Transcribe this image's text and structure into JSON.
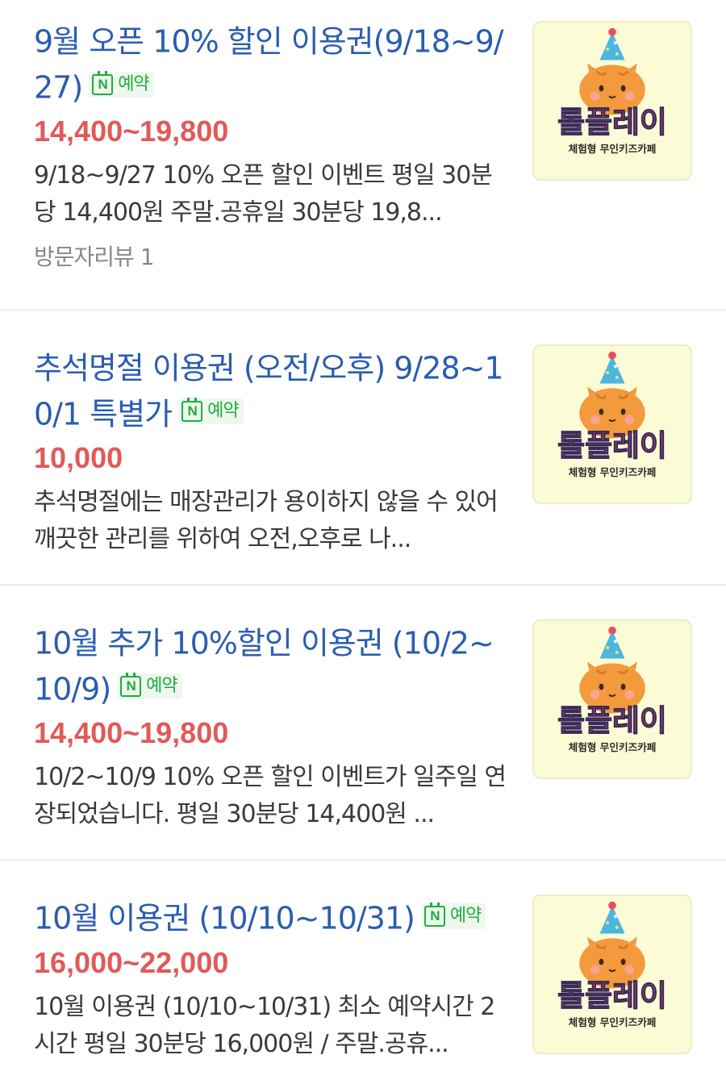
{
  "listings": [
    {
      "title": "9월 오픈 10% 할인 이용권(9/18~9/27)",
      "badge": "예약",
      "price": "14,400~19,800",
      "description": "9/18~9/27 10% 오픈 할인 이벤트 평일 30분당 14,400원 주말.공휴일 30분당 19,8...",
      "review": "방문자리뷰 1",
      "thumb": {
        "brand": "롤플레이",
        "tagline": "체험형 무인키즈카페"
      }
    },
    {
      "title": "추석명절 이용권 (오전/오후) 9/28~10/1 특별가",
      "badge": "예약",
      "price": "10,000",
      "description": "추석명절에는 매장관리가 용이하지 않을 수 있어 깨끗한 관리를 위하여 오전,오후로 나...",
      "thumb": {
        "brand": "롤플레이",
        "tagline": "체험형 무인키즈카페"
      }
    },
    {
      "title": "10월 추가 10%할인 이용권 (10/2~10/9)",
      "badge": "예약",
      "price": "14,400~19,800",
      "description": "10/2~10/9 10% 오픈 할인 이벤트가 일주일 연장되었습니다. 평일 30분당 14,400원 ...",
      "thumb": {
        "brand": "롤플레이",
        "tagline": "체험형 무인키즈카페"
      }
    },
    {
      "title": "10월 이용권 (10/10~10/31)",
      "badge": "예약",
      "price": "16,000~22,000",
      "description": "10월 이용권 (10/10~10/31) 최소 예약시간 2시간 평일 30분당 16,000원 / 주말.공휴...",
      "thumb": {
        "brand": "롤플레이",
        "tagline": "체험형 무인키즈카페"
      }
    }
  ],
  "colors": {
    "title": "#2a5db0",
    "price": "#e05a58",
    "badge_green": "#1fae3d",
    "thumb_bg": "#fbfbd6"
  },
  "icons": {
    "badge": "naver-booking-icon",
    "thumb": "cat-party-hat-logo"
  }
}
